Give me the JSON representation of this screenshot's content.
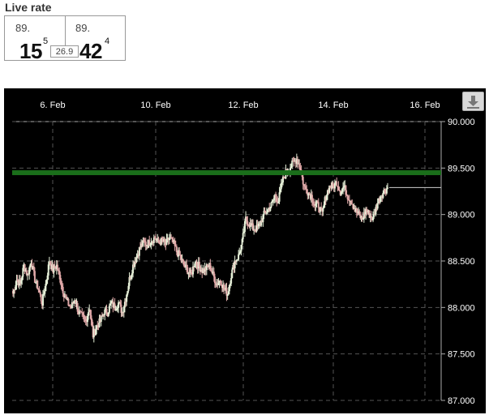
{
  "rate_panel": {
    "title": "Live rate",
    "bid_prefix": "89.",
    "bid_big": "15",
    "bid_sup": "5",
    "ask_prefix": "89.",
    "ask_big": "42",
    "ask_sup": "4",
    "spread": "26.9"
  },
  "download_button": {
    "icon": "download-icon"
  },
  "colors": {
    "background": "#000000",
    "grid": "#555555",
    "up_candle": "#e6f0d8",
    "down_candle": "#e0a8a8",
    "resistance_line": "#1a6e1a",
    "price_line": "#cfcfcf",
    "axis_text": "#ffffff"
  },
  "chart_data": {
    "type": "candlestick",
    "x_tick_labels": [
      "6. Feb",
      "10. Feb",
      "12. Feb",
      "14. Feb",
      "16. Feb"
    ],
    "y_tick_labels": [
      "90.000",
      "89.500",
      "89.000",
      "88.500",
      "88.000",
      "87.500",
      "87.000"
    ],
    "ylim": [
      87.0,
      90.0
    ],
    "horizontal_line": 89.45,
    "last_price": 89.29,
    "grid": true,
    "close_path": [
      88.15,
      88.3,
      88.25,
      88.45,
      88.35,
      88.5,
      88.3,
      88.2,
      88.05,
      88.25,
      88.5,
      88.4,
      88.45,
      88.3,
      88.15,
      88.05,
      88.0,
      88.1,
      87.95,
      87.9,
      87.85,
      88.0,
      87.7,
      87.8,
      87.85,
      87.95,
      87.95,
      88.05,
      88.0,
      88.05,
      87.95,
      88.1,
      88.3,
      88.45,
      88.55,
      88.65,
      88.7,
      88.68,
      88.72,
      88.75,
      88.7,
      88.72,
      88.68,
      88.75,
      88.7,
      88.6,
      88.55,
      88.45,
      88.4,
      88.35,
      88.5,
      88.45,
      88.4,
      88.42,
      88.45,
      88.35,
      88.25,
      88.3,
      88.2,
      88.15,
      88.35,
      88.5,
      88.55,
      88.7,
      88.95,
      88.9,
      88.85,
      88.85,
      88.9,
      89.0,
      89.05,
      89.1,
      89.2,
      89.15,
      89.35,
      89.45,
      89.5,
      89.55,
      89.6,
      89.5,
      89.3,
      89.25,
      89.2,
      89.1,
      89.1,
      89.0,
      89.2,
      89.3,
      89.3,
      89.35,
      89.25,
      89.3,
      89.2,
      89.15,
      89.05,
      89.0,
      88.95,
      89.05,
      89.0,
      88.95,
      89.1,
      89.2,
      89.25,
      89.29
    ]
  }
}
